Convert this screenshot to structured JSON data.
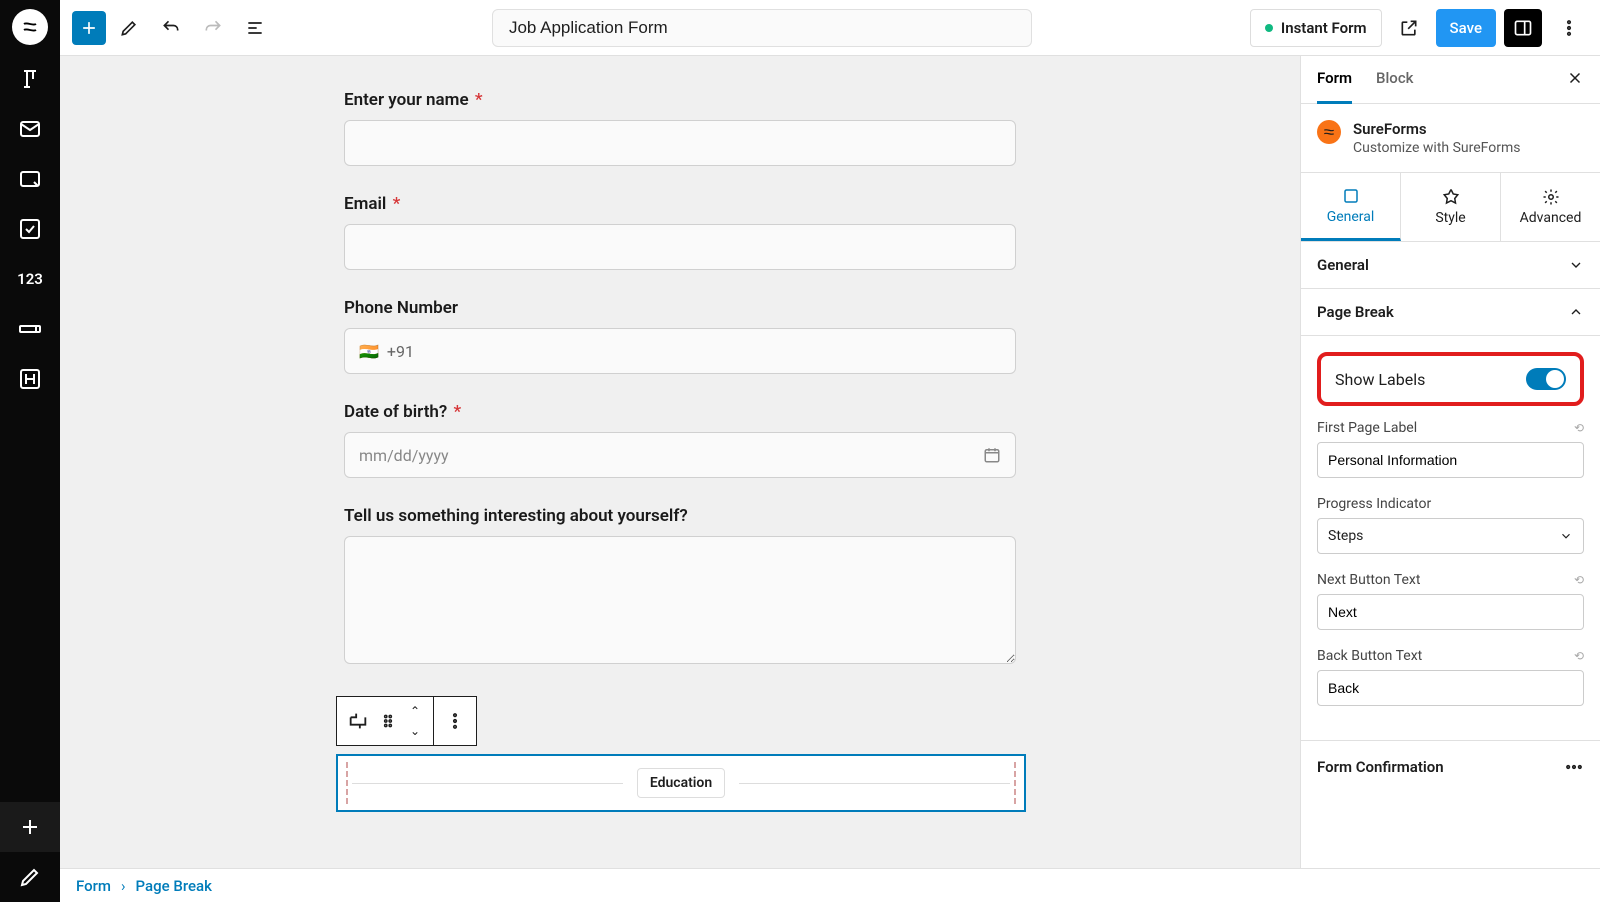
{
  "header": {
    "title": "Job Application Form",
    "instant_form": "Instant Form",
    "save": "Save"
  },
  "rail": {
    "numeric": "123"
  },
  "fields": {
    "name": {
      "label": "Enter your name",
      "required": true
    },
    "email": {
      "label": "Email",
      "required": true
    },
    "phone": {
      "label": "Phone Number",
      "prefix": "+91",
      "flag": "🇮🇳"
    },
    "dob": {
      "label": "Date of birth?",
      "required": true,
      "placeholder": "mm/dd/yyyy"
    },
    "interesting": {
      "label": "Tell us something interesting about yourself?"
    }
  },
  "page_break": {
    "label": "Education"
  },
  "inspector": {
    "tab_form": "Form",
    "tab_block": "Block",
    "product_name": "SureForms",
    "product_sub": "Customize with SureForms",
    "subtabs": {
      "general": "General",
      "style": "Style",
      "advanced": "Advanced"
    },
    "acc_general": "General",
    "acc_pagebreak": "Page Break",
    "show_labels": "Show Labels",
    "first_page_label": "First Page Label",
    "first_page_value": "Personal Information",
    "progress_label": "Progress Indicator",
    "progress_value": "Steps",
    "next_label": "Next Button Text",
    "next_value": "Next",
    "back_label": "Back Button Text",
    "back_value": "Back",
    "form_confirm": "Form Confirmation"
  },
  "footer": {
    "crumb1": "Form",
    "crumb2": "Page Break"
  }
}
